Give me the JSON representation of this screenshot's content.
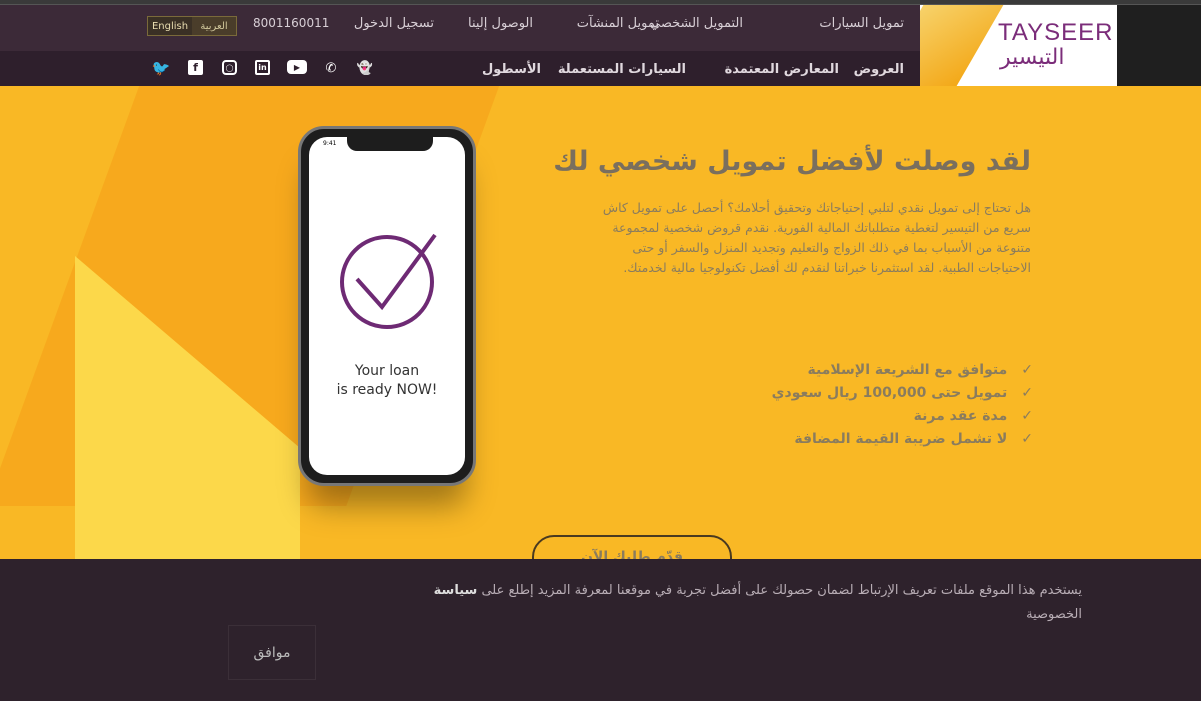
{
  "header": {
    "logo_en": "TAYSEER",
    "logo_ar": "التيسير",
    "top_nav": [
      "تمويل السيارات",
      "التمويل الشخصي",
      "تمويل المنشآت",
      "الوصول إلينا",
      "تسجيل الدخول"
    ],
    "phone": "8001160011",
    "lang": {
      "arabic": "العربية",
      "english": "English"
    },
    "main_nav": [
      "العروض",
      "المعارض المعتمدة",
      "السيارات المستعملة",
      "الأسطول"
    ],
    "social": [
      "snapchat-icon",
      "whatsapp-icon",
      "youtube-icon",
      "linkedin-icon",
      "instagram-icon",
      "facebook-icon",
      "twitter-icon"
    ]
  },
  "hero": {
    "title": "لقد وصلت لأفضل تمويل شخصي لك",
    "paragraph": "هل تحتاج إلى تمويل نقدي لتلبي إحتياجاتك وتحقيق أحلامك؟ أحصل على تمويل كاش سريع من التيسير لتغطية متطلباتك المالية الفورية. نقدم قروض شخصية لمجموعة متنوعة من الأسباب بما في ذلك الزواج والتعليم وتجديد المنزل والسفر أو حتى الاحتياجات الطبية. لقد استثمرنا خبراتنا لنقدم لك أفضل تكنولوجيا مالية لخدمتك.",
    "features": [
      "متوافق مع الشريعة الإسلامية",
      "تمويل حتى 100,000 ريال سعودي",
      "مدة عقد مرنة",
      "لا تشمل ضريبة القيمة المضافة"
    ],
    "check_mark": "✓",
    "phone_time": "9:41",
    "phone_line1": "Your loan",
    "phone_line2": "is ready NOW!",
    "apply_label": "قدّم طلبك الآن"
  },
  "cookie": {
    "text": "يستخدم هذا الموقع ملفات تعريف الإرتباط لضمان حصولك على أفضل تجربة في موقعنا لمعرفة المزيد إطلع على",
    "link": "سياسة",
    "text2": "الخصوصية",
    "agree": "موافق"
  },
  "colors": {
    "brand": "#7b2d7a",
    "hero_bg": "#f9b825",
    "nav_bg": "#3c2a38",
    "cookie_bg": "#2e222c"
  }
}
